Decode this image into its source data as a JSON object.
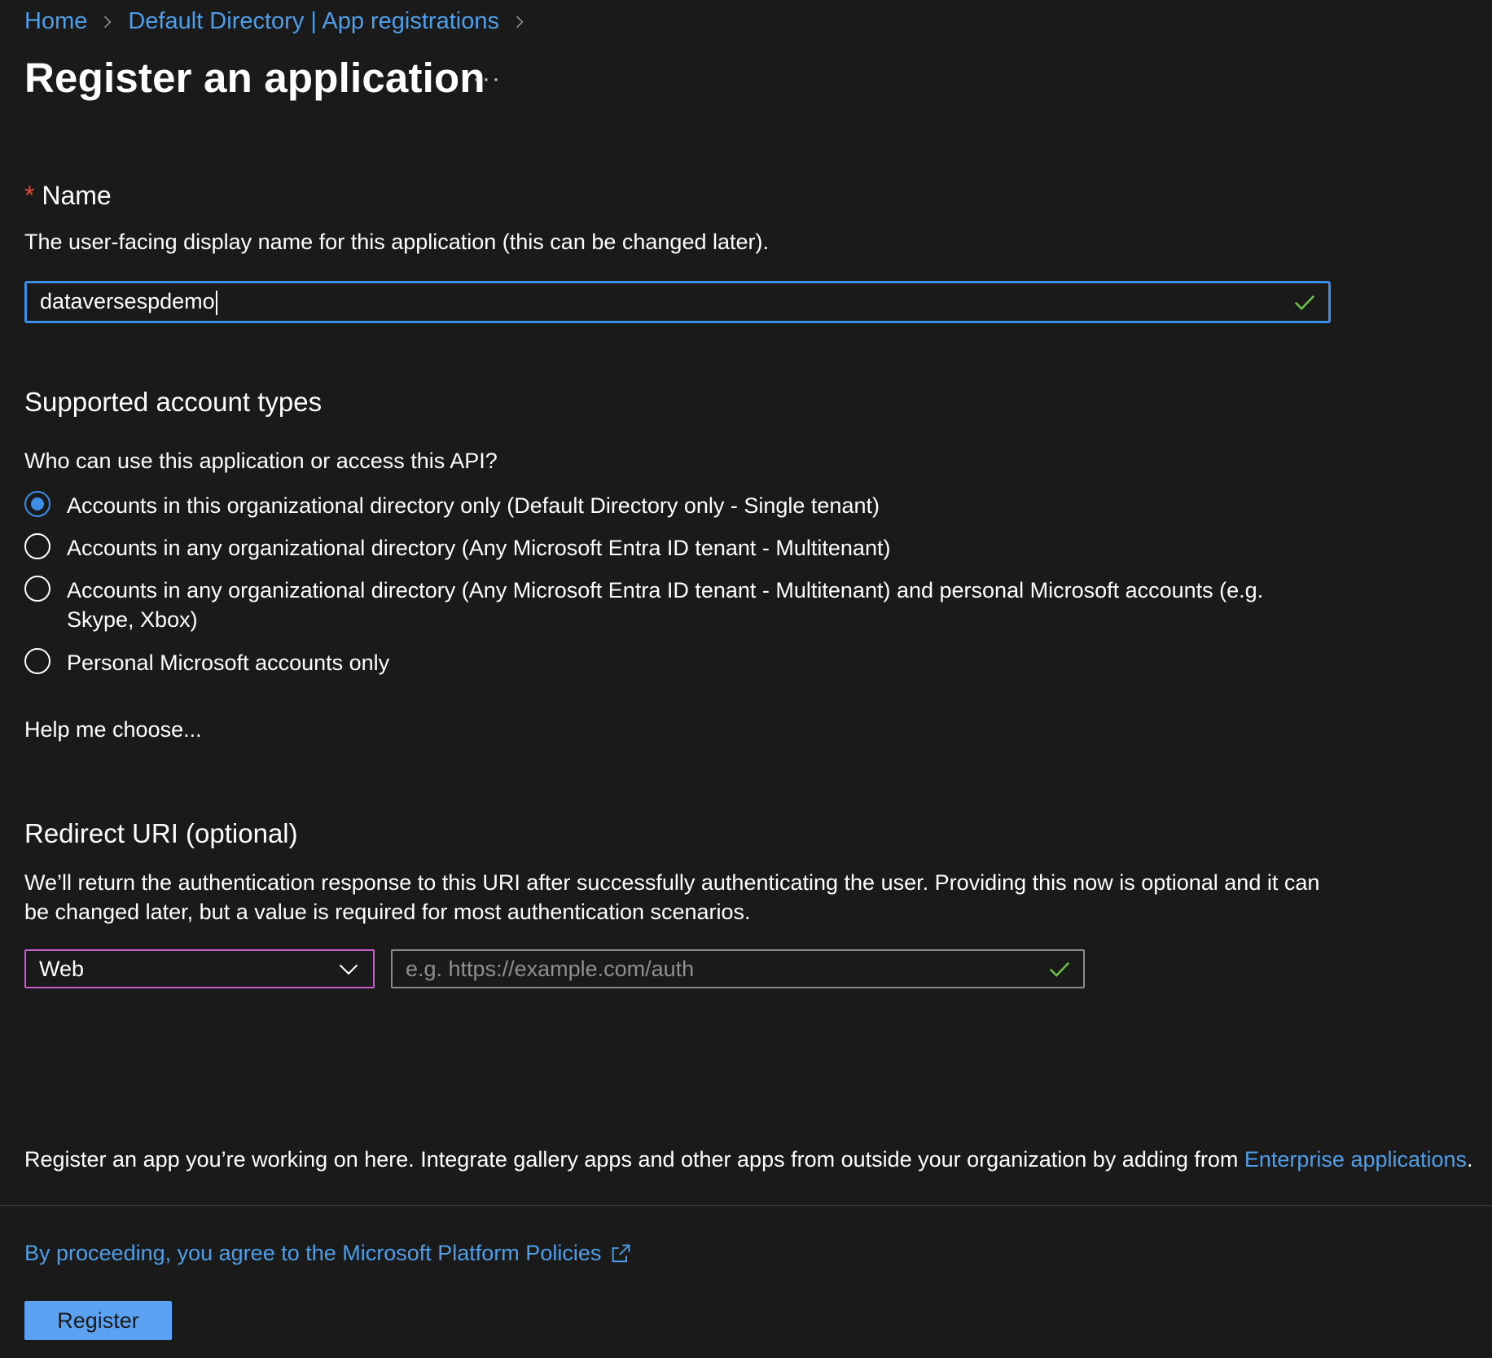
{
  "breadcrumb": {
    "items": [
      "Home",
      "Default Directory | App registrations"
    ]
  },
  "page": {
    "title": "Register an application",
    "more_label": "···"
  },
  "name_section": {
    "required_marker": "*",
    "label": "Name",
    "description": "The user-facing display name for this application (this can be changed later).",
    "value": "dataversespdemo"
  },
  "account_types": {
    "heading": "Supported account types",
    "question": "Who can use this application or access this API?",
    "options": [
      {
        "label": "Accounts in this organizational directory only (Default Directory only - Single tenant)",
        "selected": true
      },
      {
        "label": "Accounts in any organizational directory (Any Microsoft Entra ID tenant - Multitenant)",
        "selected": false
      },
      {
        "label": "Accounts in any organizational directory (Any Microsoft Entra ID tenant - Multitenant) and personal Microsoft accounts (e.g. Skype, Xbox)",
        "selected": false
      },
      {
        "label": "Personal Microsoft accounts only",
        "selected": false
      }
    ],
    "help_link": "Help me choose..."
  },
  "redirect": {
    "heading": "Redirect URI (optional)",
    "description": "We’ll return the authentication response to this URI after successfully authenticating the user. Providing this now is optional and it can be changed later, but a value is required for most authentication scenarios.",
    "platform_value": "Web",
    "uri_placeholder": "e.g. https://example.com/auth",
    "uri_value": ""
  },
  "footer": {
    "note_text": "Register an app you’re working on here. Integrate gallery apps and other apps from outside your organization by adding from ",
    "note_link": "Enterprise applications",
    "note_end": ".",
    "policy_link": "By proceeding, you agree to the Microsoft Platform Policies",
    "register_label": "Register"
  },
  "colors": {
    "background": "#1b1a1a",
    "link": "#4f9ee8",
    "accent": "#3d8ee6",
    "valid_check": "#6cc24a",
    "required": "#e04b3a",
    "register_button": "#5ba3f2"
  },
  "icons": {
    "breadcrumb_separator": "chevron-right-icon",
    "valid": "checkmark-icon",
    "select_caret": "chevron-down-icon",
    "external": "external-link-icon"
  }
}
